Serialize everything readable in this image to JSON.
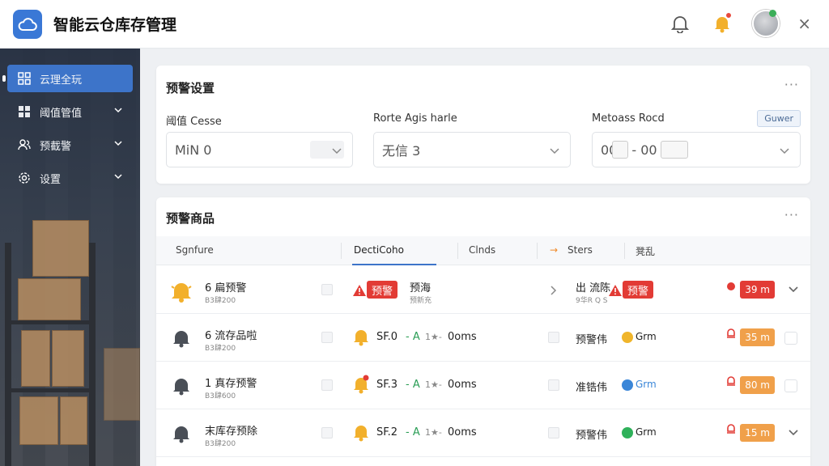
{
  "header": {
    "app_title": "智能云仓库存管理",
    "icons": [
      "cloud-icon",
      "bell-icon",
      "bell-alert-icon",
      "avatar",
      "close-icon"
    ],
    "close_glyph": "×"
  },
  "sidebar": {
    "items": [
      {
        "label": "云理全玩",
        "icon": "grid-icon",
        "active": true
      },
      {
        "label": "阈值管值",
        "icon": "dashboard-icon",
        "active": false
      },
      {
        "label": "预截警",
        "icon": "users-icon",
        "active": false
      },
      {
        "label": "设置",
        "icon": "gear-icon",
        "active": false
      }
    ]
  },
  "settings_card": {
    "title": "预警设置",
    "more": "···",
    "button_label": "Guwer",
    "fields": [
      {
        "label": "阈值 Cesse",
        "value": "MiN 0"
      },
      {
        "label": "Rorte Agis harle",
        "value": "无信 3"
      },
      {
        "label": "Metoass Rocd",
        "value_left": "00",
        "value_mid": "- 00"
      }
    ]
  },
  "items_card": {
    "title": "预警商品",
    "more": "···",
    "tabs": [
      "Sgnfure",
      "DectiCoho",
      "Clnds",
      "Sters",
      "凳乱"
    ],
    "tab_arrow": "→",
    "rows": [
      {
        "title": "6 扁预警",
        "sub": "B3肆200",
        "mid_pill": "预警",
        "mid_text": "预海",
        "mid_sub": "预新充",
        "right_text": "出 流陈",
        "right_sub": "9华R Q S",
        "right_pill": "预警",
        "time": "39 m",
        "time_color": "#e23b35"
      },
      {
        "title": "6 流存品啦",
        "sub": "B3肆200",
        "metric": "SF.0",
        "trend": "- A",
        "trend2": "1★-",
        "ms": "0oms",
        "status_text": "预警伟",
        "status_color": "#f0b52b",
        "status_suffix": "Grm",
        "time": "35 m",
        "time_color": "#f0a04a"
      },
      {
        "title": "1 真存预警",
        "sub": "B3肆600",
        "metric": "SF.3",
        "trend": "- A",
        "trend2": "1★-",
        "ms": "0oms",
        "status_text": "准锆伟",
        "status_color": "#3a86d8",
        "status_suffix": "Grm",
        "time": "80 m",
        "time_color": "#f0a04a"
      },
      {
        "title": "末库存预除",
        "sub": "B3肆200",
        "metric": "SF.2",
        "trend": "- A",
        "trend2": "1★-",
        "ms": "0oms",
        "status_text": "预警伟",
        "status_color": "#2fb15a",
        "status_suffix": "Grm",
        "time": "15 m",
        "time_color": "#f0a04a"
      }
    ]
  }
}
